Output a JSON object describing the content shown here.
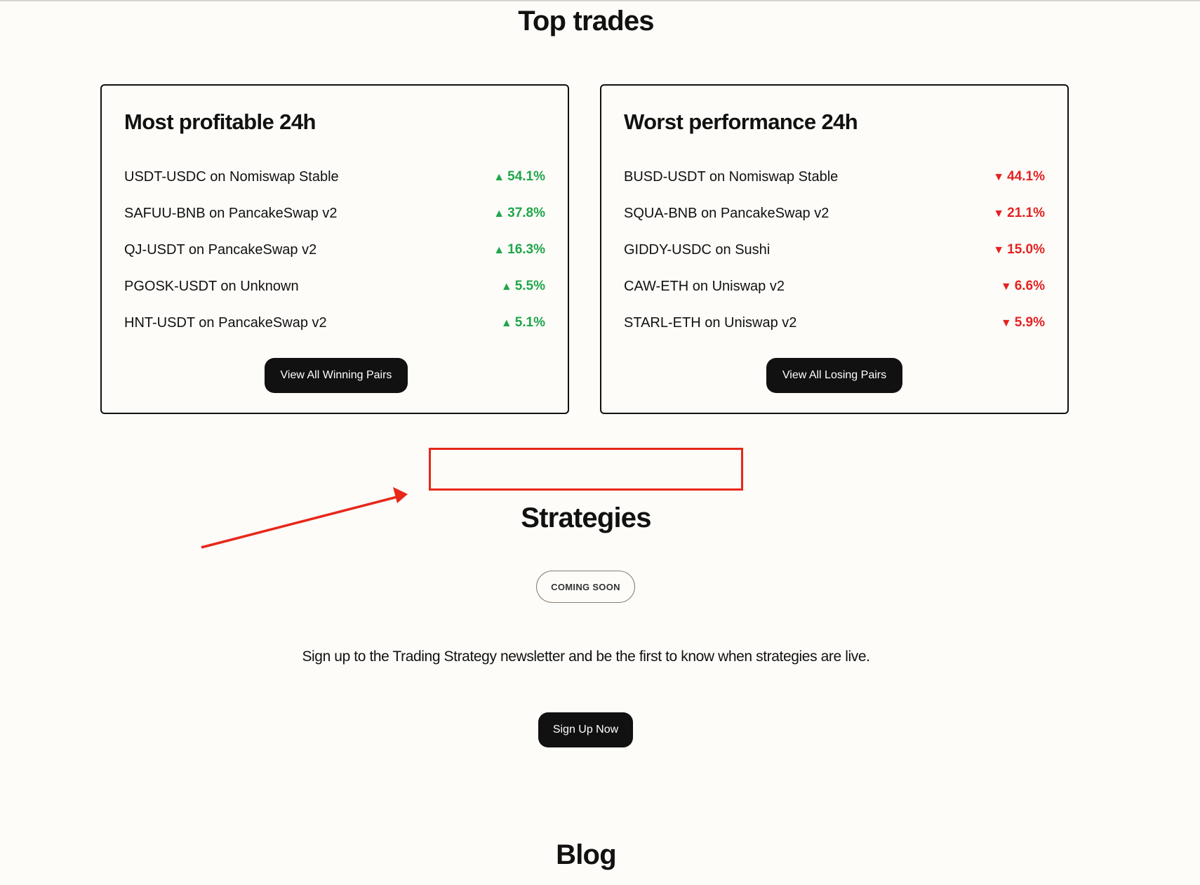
{
  "sections": {
    "top_trades_title": "Top trades",
    "strategies_title": "Strategies",
    "blog_title": "Blog"
  },
  "winners": {
    "title": "Most profitable 24h",
    "items": [
      {
        "pair": "USDT-USDC on Nomiswap Stable",
        "change": "54.1%"
      },
      {
        "pair": "SAFUU-BNB on PancakeSwap v2",
        "change": "37.8%"
      },
      {
        "pair": "QJ-USDT on PancakeSwap v2",
        "change": "16.3%"
      },
      {
        "pair": "PGOSK-USDT on Unknown",
        "change": "5.5%"
      },
      {
        "pair": "HNT-USDT on PancakeSwap v2",
        "change": "5.1%"
      }
    ],
    "button_label": "View All Winning Pairs",
    "arrow": "▲",
    "color": "#1fa64a"
  },
  "losers": {
    "title": "Worst performance 24h",
    "items": [
      {
        "pair": "BUSD-USDT on Nomiswap Stable",
        "change": "44.1%"
      },
      {
        "pair": "SQUA-BNB on PancakeSwap v2",
        "change": "21.1%"
      },
      {
        "pair": "GIDDY-USDC on Sushi",
        "change": "15.0%"
      },
      {
        "pair": "CAW-ETH on Uniswap v2",
        "change": "6.6%"
      },
      {
        "pair": "STARL-ETH on Uniswap v2",
        "change": "5.9%"
      }
    ],
    "button_label": "View All Losing Pairs",
    "arrow": "▼",
    "color": "#e42222"
  },
  "strategies": {
    "badge": "COMING SOON",
    "text": "Sign up to the Trading Strategy newsletter and be the first to know when strategies are live.",
    "button_label": "Sign Up Now"
  },
  "annotation": {
    "color": "#e8271a"
  }
}
